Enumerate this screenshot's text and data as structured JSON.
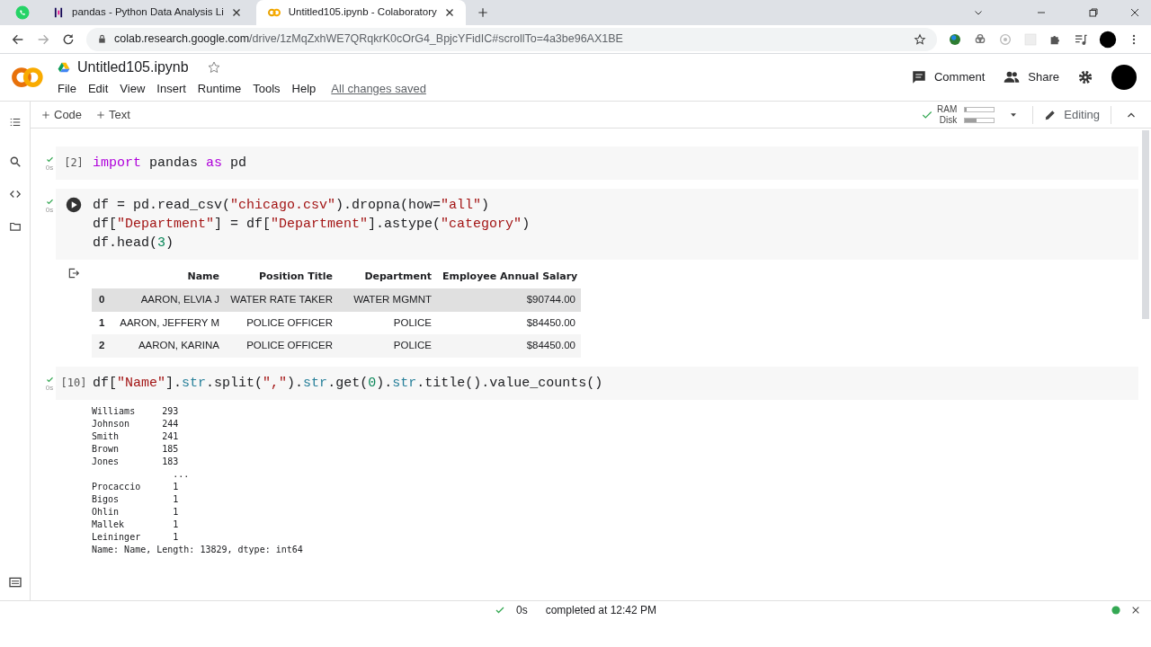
{
  "browser": {
    "tabs": [
      {
        "title": "pandas - Python Data Analysis Li",
        "selected": false
      },
      {
        "title": "Untitled105.ipynb - Colaboratory",
        "selected": true
      }
    ],
    "url_host": "colab.research.google.com",
    "url_path": "/drive/1zMqZxhWE7QRqkrK0cOrG4_BpjcYFidIC#scrollTo=4a3be96AX1BE"
  },
  "notebook": {
    "title": "Untitled105.ipynb",
    "menu": [
      "File",
      "Edit",
      "View",
      "Insert",
      "Runtime",
      "Tools",
      "Help"
    ],
    "save_status": "All changes saved",
    "actions": [
      "Comment",
      "Share"
    ]
  },
  "toolbar": {
    "add_buttons": [
      "Code",
      "Text"
    ],
    "resources": [
      {
        "label": "RAM",
        "level": 0.04
      },
      {
        "label": "Disk",
        "level": 0.4
      }
    ],
    "mode": "Editing"
  },
  "cells": [
    {
      "kind": "code",
      "exec": "[2]",
      "time": "0s",
      "lines": [
        [
          {
            "text": "import",
            "kind": "keyword"
          },
          {
            "text": " pandas ",
            "kind": "plain"
          },
          {
            "text": "as",
            "kind": "keyword"
          },
          {
            "text": " pd",
            "kind": "plain"
          }
        ]
      ]
    },
    {
      "kind": "code",
      "time": "0s",
      "lines": [
        [
          {
            "text": "df = pd.read_csv(",
            "kind": "plain"
          },
          {
            "text": "\"chicago.csv\"",
            "kind": "string"
          },
          {
            "text": ").dropna(how=",
            "kind": "plain"
          },
          {
            "text": "\"all\"",
            "kind": "string"
          },
          {
            "text": ")",
            "kind": "plain"
          }
        ],
        [
          {
            "text": "df[",
            "kind": "plain"
          },
          {
            "text": "\"Department\"",
            "kind": "string"
          },
          {
            "text": "] = df[",
            "kind": "plain"
          },
          {
            "text": "\"Department\"",
            "kind": "string"
          },
          {
            "text": "].astype(",
            "kind": "plain"
          },
          {
            "text": "\"category\"",
            "kind": "string"
          },
          {
            "text": ")",
            "kind": "plain"
          }
        ],
        [
          {
            "text": "df.head(",
            "kind": "plain"
          },
          {
            "text": "3",
            "kind": "number"
          },
          {
            "text": ")",
            "kind": "plain"
          }
        ]
      ],
      "output": {
        "kind": "table",
        "columns": [
          "",
          "Name",
          "Position Title",
          "Department",
          "Employee Annual Salary"
        ],
        "rows": [
          {
            "selected": true,
            "cells": [
              "0",
              "AARON, ELVIA J",
              "WATER RATE TAKER",
              "WATER MGMNT",
              "$90744.00"
            ]
          },
          {
            "selected": false,
            "cells": [
              "1",
              "AARON, JEFFERY M",
              "POLICE OFFICER",
              "POLICE",
              "$84450.00"
            ]
          },
          {
            "selected": false,
            "cells": [
              "2",
              "AARON, KARINA",
              "POLICE OFFICER",
              "POLICE",
              "$84450.00"
            ]
          }
        ]
      }
    },
    {
      "kind": "code",
      "exec": "[10]",
      "time": "0s",
      "lines": [
        [
          {
            "text": "df[",
            "kind": "plain"
          },
          {
            "text": "\"Name\"",
            "kind": "string"
          },
          {
            "text": "].",
            "kind": "plain"
          },
          {
            "text": "str",
            "kind": "attr"
          },
          {
            "text": ".split(",
            "kind": "plain"
          },
          {
            "text": "\",\"",
            "kind": "string"
          },
          {
            "text": ").",
            "kind": "plain"
          },
          {
            "text": "str",
            "kind": "attr"
          },
          {
            "text": ".get(",
            "kind": "plain"
          },
          {
            "text": "0",
            "kind": "number"
          },
          {
            "text": ").",
            "kind": "plain"
          },
          {
            "text": "str",
            "kind": "attr"
          },
          {
            "text": ".title().value_counts()",
            "kind": "plain"
          }
        ]
      ],
      "output": {
        "kind": "text",
        "lines": [
          "Williams     293",
          "Johnson      244",
          "Smith        241",
          "Brown        185",
          "Jones        183",
          "               ...",
          "Procaccio      1",
          "Bigos          1",
          "Ohlin          1",
          "Mallek         1",
          "Leininger      1",
          "Name: Name, Length: 13829, dtype: int64"
        ]
      }
    }
  ],
  "status_bar": {
    "time": "0s",
    "message": "completed at 12:42 PM"
  }
}
